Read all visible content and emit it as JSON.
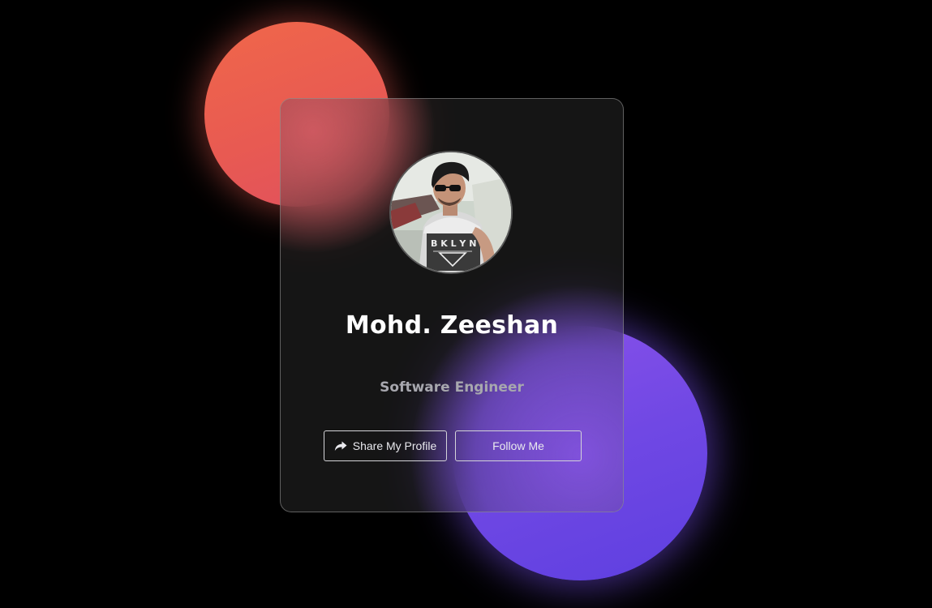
{
  "profile": {
    "name": "Mohd. Zeeshan",
    "role": "Software Engineer",
    "avatar_icon": "user-photo"
  },
  "actions": {
    "share_label": "Share My Profile",
    "share_icon": "share-arrow-icon",
    "follow_label": "Follow Me"
  },
  "theme": {
    "background": "#000000",
    "orb_red": "#e85a52",
    "orb_purple": "#7048e4",
    "card_border": "#d4d4d8",
    "name_color": "#ffffff",
    "role_color": "#a7a7ae"
  }
}
